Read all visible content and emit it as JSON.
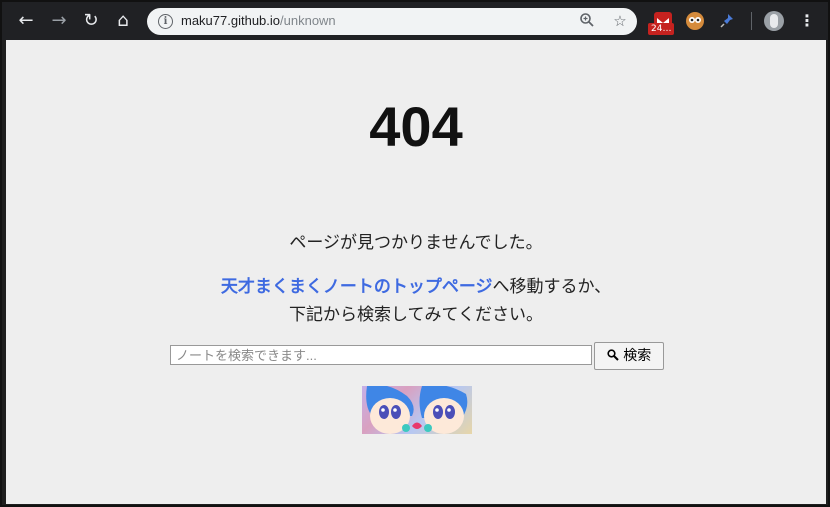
{
  "browser": {
    "url_host": "maku77.github.io",
    "url_path": "/unknown",
    "ext_badge": "24…"
  },
  "page": {
    "code": "404",
    "not_found": "ページが見つかりませんでした。",
    "top_link": "天才まくまくノートのトップページ",
    "move_suffix": "へ移動するか、",
    "search_hint": "下記から検索してみてください。",
    "search_placeholder": "ノートを検索できます...",
    "search_button": "検索"
  },
  "colors": {
    "link": "#3e6ae1",
    "background": "#eeeeee"
  }
}
